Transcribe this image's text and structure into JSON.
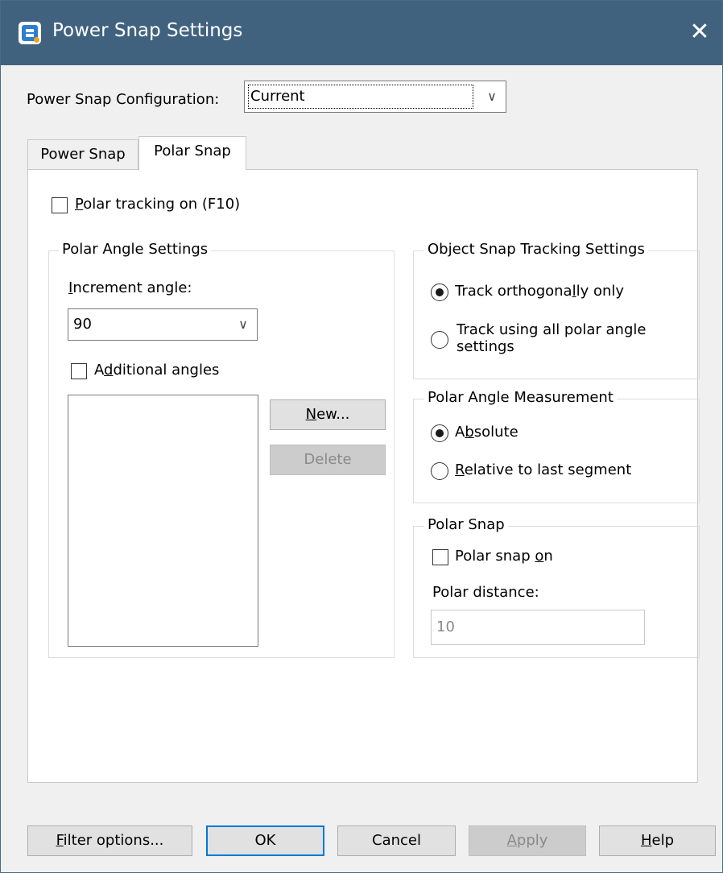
{
  "window": {
    "title": "Power Snap Settings",
    "close_glyph": "✕"
  },
  "config": {
    "label": "Power Snap Configuration:",
    "selected": "Current"
  },
  "tabs": [
    {
      "label": "Power Snap",
      "active": false
    },
    {
      "label": "Polar Snap",
      "active": true
    }
  ],
  "polar_tracking": {
    "label_mnemonic": "P",
    "label_rest": "olar tracking on (F10)",
    "checked": false
  },
  "polar_angle_settings": {
    "legend": "Polar Angle Settings",
    "increment_label_mnemonic": "I",
    "increment_label_rest": "ncrement angle:",
    "increment_value": "90",
    "additional_pre": "A",
    "additional_mnemonic": "d",
    "additional_rest": "ditional angles",
    "additional_checked": false,
    "angles": [],
    "new_mnemonic": "N",
    "new_rest": "ew...",
    "delete_label": "Delete"
  },
  "object_snap_tracking": {
    "legend": "Object Snap Tracking Settings",
    "opt1_pre": "Track orthogona",
    "opt1_mnemonic": "l",
    "opt1_rest": "ly only",
    "opt1_selected": true,
    "opt2_line1": "Track using all polar angle",
    "opt2_line2": "settings",
    "opt2_selected": false
  },
  "polar_angle_measurement": {
    "legend": "Polar Angle Measurement",
    "abs_pre": "A",
    "abs_mnemonic": "b",
    "abs_rest": "solute",
    "abs_selected": true,
    "rel_mnemonic": "R",
    "rel_rest": "elative to last segment",
    "rel_selected": false
  },
  "polar_snap": {
    "legend": "Polar Snap",
    "on_pre": "Polar snap ",
    "on_mnemonic": "o",
    "on_rest": "n",
    "on_checked": false,
    "distance_label": "Polar distance:",
    "distance_value": "10"
  },
  "buttons": {
    "filter_mnemonic": "F",
    "filter_rest": "ilter options...",
    "ok": "OK",
    "cancel": "Cancel",
    "apply_mnemonic": "A",
    "apply_rest": "pply",
    "help_mnemonic": "H",
    "help_rest": "elp"
  },
  "colors": {
    "titlebar": "#41627f",
    "dialog_bg": "#f0f0f0",
    "default_button_border": "#0078d7"
  }
}
